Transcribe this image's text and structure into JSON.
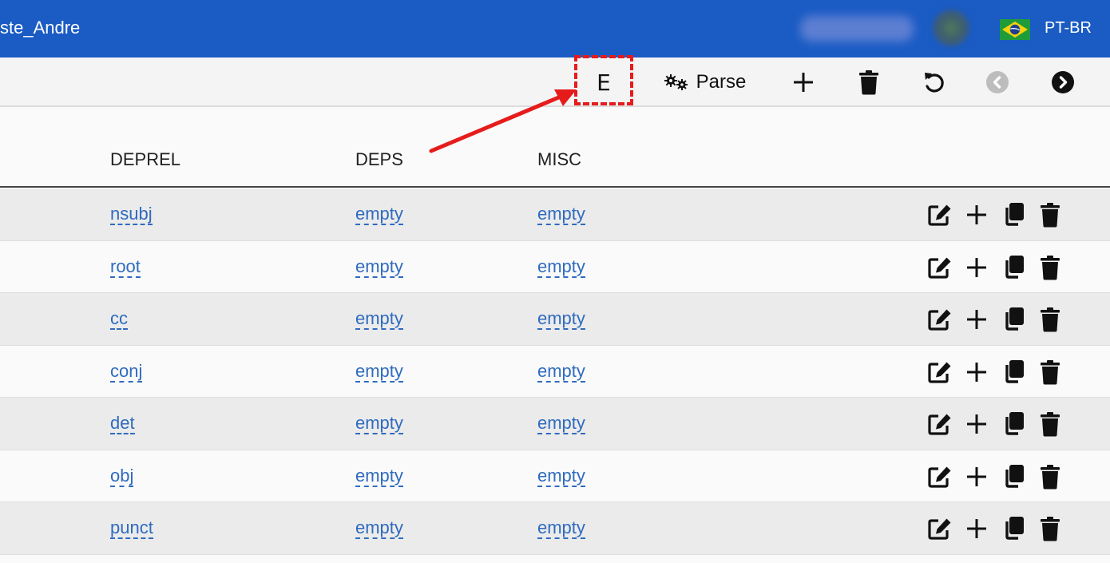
{
  "header": {
    "title": "ste_Andre",
    "user_name": "André Rosa",
    "language": "PT-BR"
  },
  "toolbar": {
    "edit_label": "E",
    "parse_label": "Parse",
    "icons": [
      "gears-icon",
      "plus-icon",
      "trash-icon",
      "undo-icon",
      "chevron-left-circle-icon",
      "chevron-right-circle-icon"
    ]
  },
  "table": {
    "columns": [
      "DEPREL",
      "DEPS",
      "MISC"
    ],
    "rows": [
      {
        "deprel": "nsubj",
        "deps": "empty",
        "misc": "empty"
      },
      {
        "deprel": "root",
        "deps": "empty",
        "misc": "empty"
      },
      {
        "deprel": "cc",
        "deps": "empty",
        "misc": "empty"
      },
      {
        "deprel": "conj",
        "deps": "empty",
        "misc": "empty"
      },
      {
        "deprel": "det",
        "deps": "empty",
        "misc": "empty"
      },
      {
        "deprel": "obj",
        "deps": "empty",
        "misc": "empty"
      },
      {
        "deprel": "punct",
        "deps": "empty",
        "misc": "empty"
      }
    ],
    "row_actions": [
      "edit-icon",
      "plus-icon",
      "copy-icon",
      "trash-icon"
    ]
  },
  "colors": {
    "header_bg": "#1a5bc4",
    "link": "#2f6bbf",
    "annotation": "#e61c1c"
  }
}
